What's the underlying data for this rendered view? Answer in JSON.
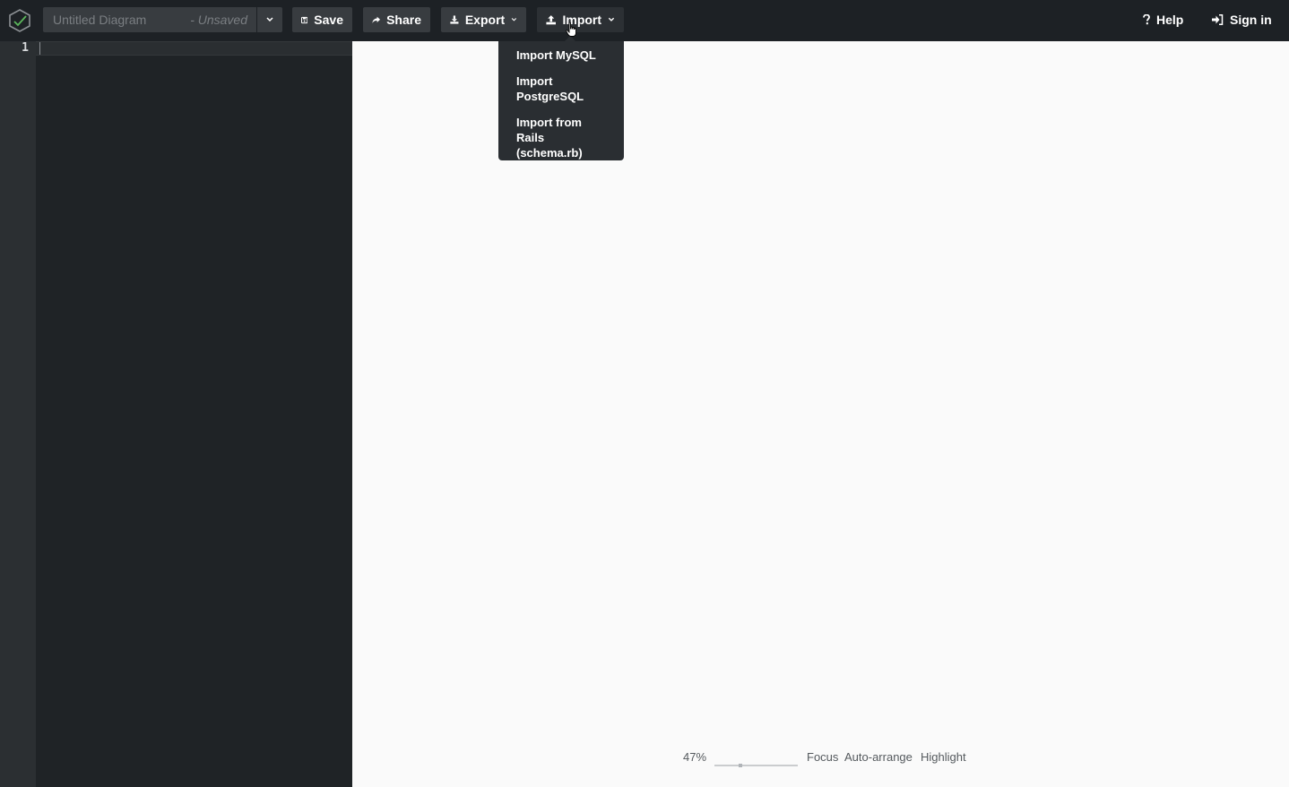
{
  "header": {
    "diagram_title_placeholder": "Untitled Diagram",
    "save_state": "- Unsaved",
    "buttons": {
      "save": "Save",
      "share": "Share",
      "export": "Export",
      "import": "Import"
    },
    "links": {
      "help": "Help",
      "sign_in": "Sign in"
    }
  },
  "import_menu": {
    "items": [
      {
        "label": "Import MySQL"
      },
      {
        "label": "Import PostgreSQL"
      },
      {
        "label": "Import from Rails (schema.rb)"
      }
    ]
  },
  "editor": {
    "line_numbers": [
      "1"
    ]
  },
  "canvas_controls": {
    "zoom_label": "47%",
    "zoom_level_fraction": 0.3,
    "focus": "Focus",
    "auto_arrange": "Auto-arrange",
    "highlight": "Highlight"
  },
  "colors": {
    "topbar": "#1d2125",
    "button": "#383c40",
    "editor": "#1f2326",
    "gutter": "#2b2f32",
    "canvas": "#fafafa",
    "logo_accent": "#5cb85c"
  }
}
